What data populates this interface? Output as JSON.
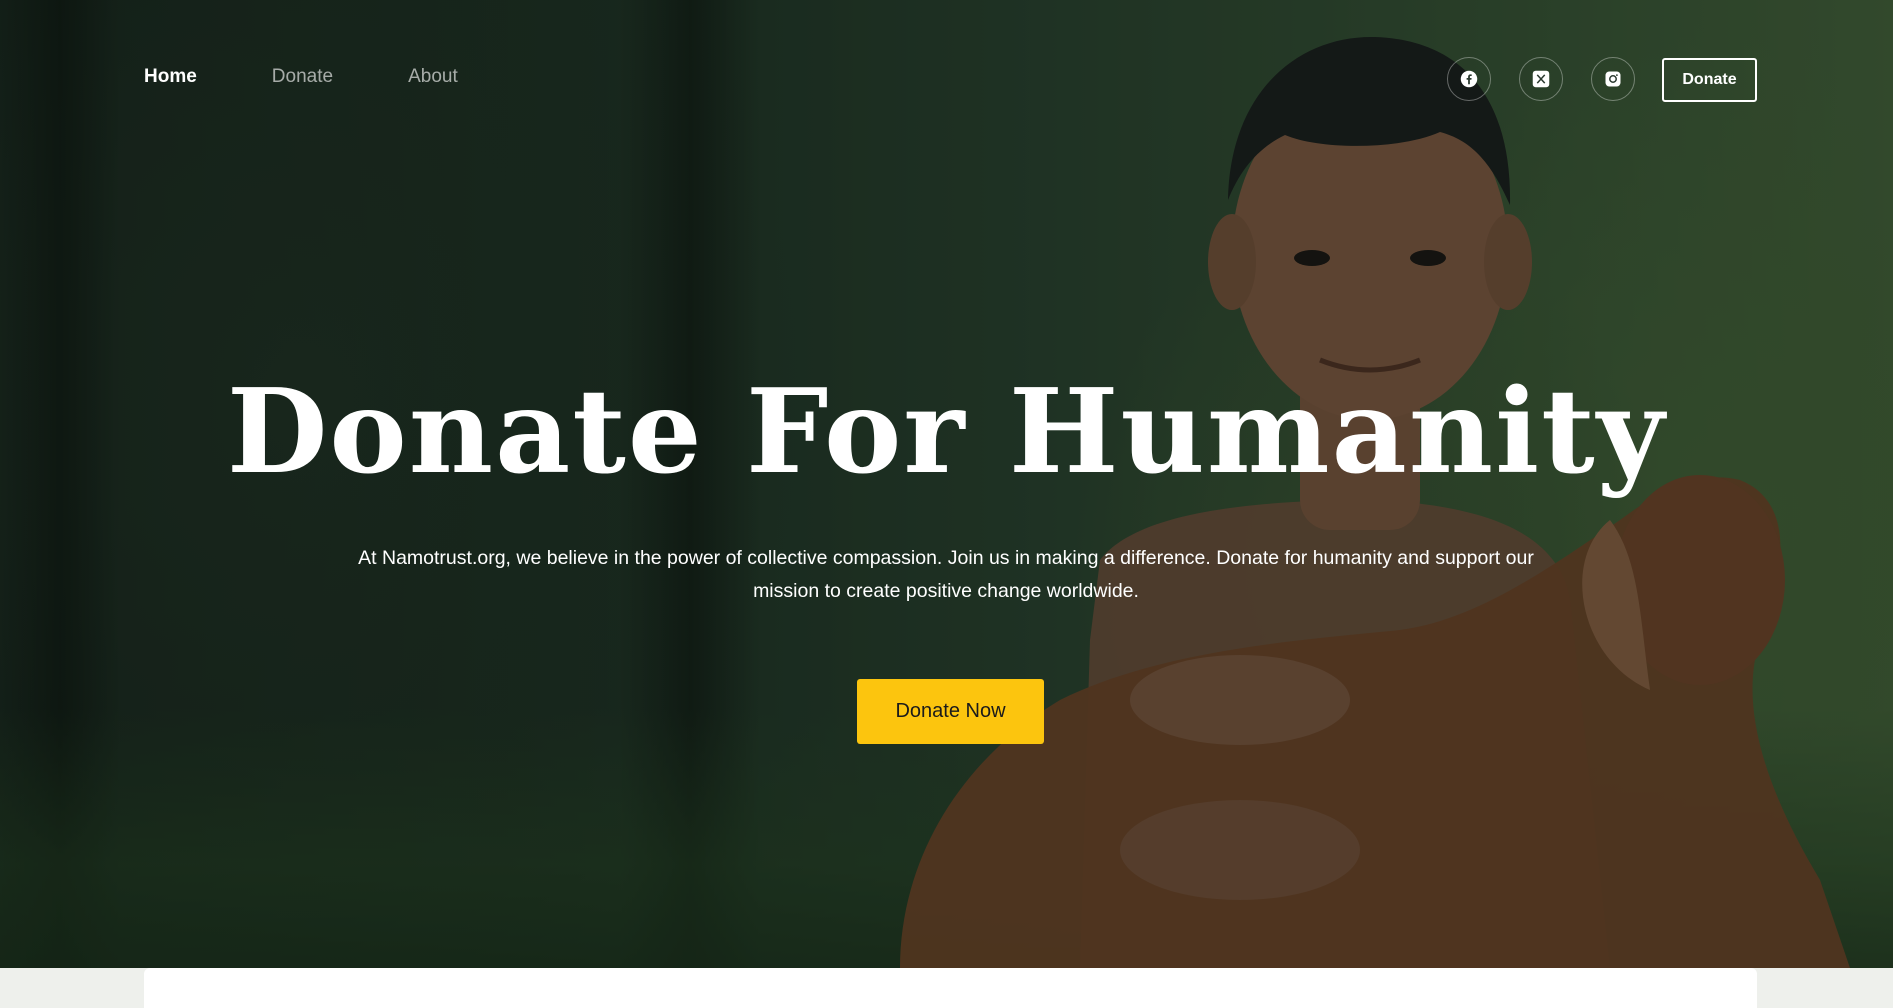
{
  "nav": {
    "items": [
      {
        "label": "Home",
        "active": true
      },
      {
        "label": "Donate",
        "active": false
      },
      {
        "label": "About",
        "active": false
      }
    ]
  },
  "social": {
    "icons": [
      "facebook-icon",
      "x-twitter-icon",
      "instagram-icon"
    ]
  },
  "header": {
    "donate_label": "Donate"
  },
  "hero": {
    "title": "Donate For Humanity",
    "description": "At Namotrust.org, we believe in the power of collective compassion. Join us in making a difference. Donate for humanity and support our mission to create positive change worldwide.",
    "cta_label": "Donate Now"
  },
  "colors": {
    "accent": "#fcc50e",
    "text": "#ffffff",
    "nav_inactive": "rgba(255,255,255,0.62)"
  }
}
